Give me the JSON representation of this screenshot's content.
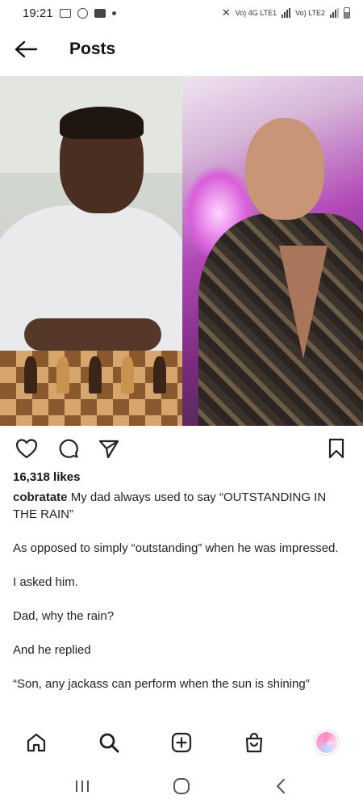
{
  "status_bar": {
    "time": "19:21",
    "network": "Vo) 4G LTE1",
    "network2": "Vo) LTE2"
  },
  "header": {
    "title": "Posts"
  },
  "post": {
    "likes": "16,318 likes",
    "username": "cobratate",
    "caption_lines": [
      "My dad always used to say “OUTSTANDING IN THE RAIN”",
      "As opposed to simply “outstanding” when he was impressed.",
      "I asked him.",
      "Dad, why the rain?",
      "And he replied",
      "“Son, any jackass can perform when the sun is shining”"
    ]
  },
  "icons": {
    "back": "arrow-left-icon",
    "like": "heart-icon",
    "comment": "comment-icon",
    "share": "send-icon",
    "save": "bookmark-icon",
    "home": "home-icon",
    "search": "search-icon",
    "create": "plus-square-icon",
    "shop": "shop-bag-icon",
    "profile": "profile-avatar",
    "recents": "recents-icon",
    "home_sys": "home-circle-icon",
    "back_sys": "chevron-left-icon"
  },
  "colors": {
    "text": "#111111",
    "background": "#ffffff",
    "icon": "#222222"
  }
}
